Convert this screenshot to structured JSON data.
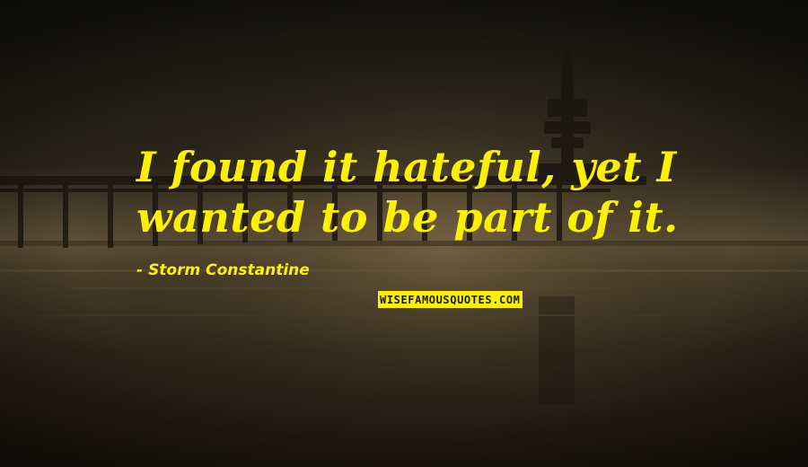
{
  "quote": {
    "lines": [
      "I found it hateful, yet I",
      "wanted to be part of it."
    ]
  },
  "author": {
    "dash": "-",
    "name": "Storm Constantine"
  },
  "watermark": {
    "text": "WISEFAMOUSQUOTES.COM"
  },
  "colors": {
    "text": "#fef100",
    "sky_dark": "#1c1710",
    "horizon_glow": "#6b5a3c"
  }
}
